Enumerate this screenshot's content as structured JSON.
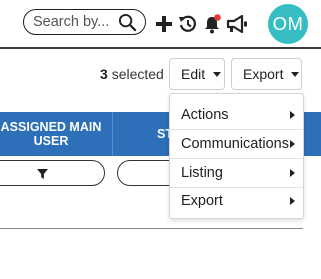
{
  "topbar": {
    "search": {
      "placeholder": "Search by...",
      "icon": "search-icon"
    },
    "icons": [
      "plus-icon",
      "history-icon",
      "notification-bell-icon",
      "announcement-megaphone-icon"
    ],
    "notification_dot_color": "#e53935",
    "avatar": {
      "initials": "OM",
      "color": "#36bec3"
    }
  },
  "toolbar": {
    "selected_count": "3",
    "selected_label": "selected",
    "edit_label": "Edit",
    "export_label": "Export"
  },
  "table": {
    "header_color": "#2d6fb8",
    "columns": [
      {
        "label": "ASSIGNED MAIN USER"
      },
      {
        "label": "ST"
      }
    ],
    "filter_icon": "filter-icon"
  },
  "dropdown": {
    "items": [
      {
        "label": "Actions"
      },
      {
        "label": "Communications"
      },
      {
        "label": "Listing"
      },
      {
        "label": "Export"
      }
    ]
  }
}
